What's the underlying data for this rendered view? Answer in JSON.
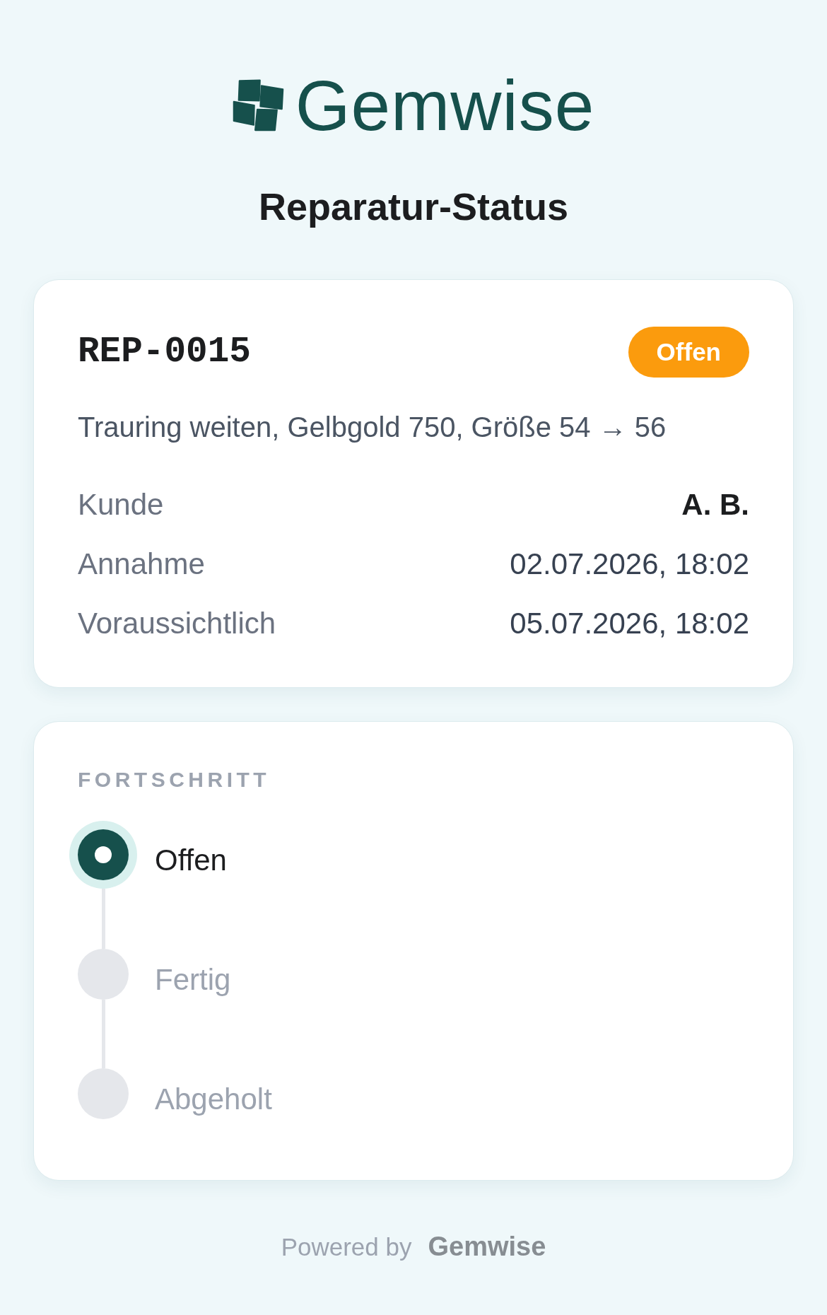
{
  "brand": {
    "name": "Gemwise"
  },
  "heading": "Reparatur-Status",
  "repair": {
    "number": "REP-0015",
    "status": {
      "label": "Offen",
      "kind": "open"
    },
    "description": "Trauring weiten, Gelbgold 750, Größe 54 → 56",
    "details": [
      {
        "label": "Kunde",
        "value": "A. B.",
        "kind": "name"
      },
      {
        "label": "Annahme",
        "value": "02.07.2026, 18:02",
        "kind": "date"
      },
      {
        "label": "Voraussichtlich",
        "value": "05.07.2026, 18:02",
        "kind": "date"
      }
    ]
  },
  "progress": {
    "title": "FORTSCHRITT",
    "steps": [
      {
        "label": "Offen",
        "active": true
      },
      {
        "label": "Fertig",
        "active": false
      },
      {
        "label": "Abgeholt",
        "active": false
      }
    ]
  },
  "footer": {
    "prefix": "Powered by",
    "brand": "Gemwise"
  }
}
